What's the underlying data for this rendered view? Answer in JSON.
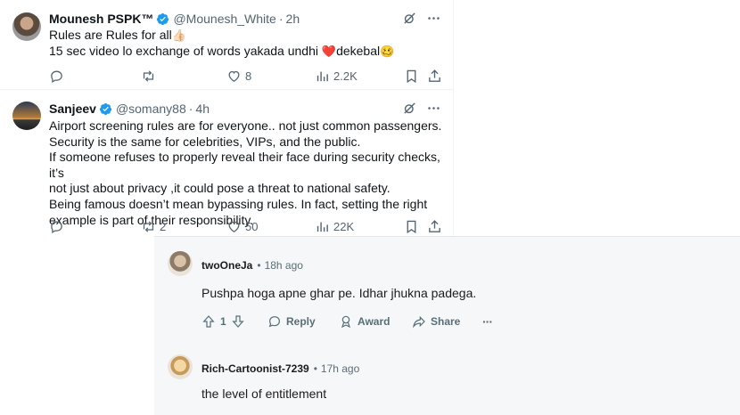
{
  "twitter": {
    "tweets": [
      {
        "name": "Mounesh PSPK™",
        "handle": "@Mounesh_White",
        "time": "2h",
        "lines": [
          "Rules are Rules for all",
          " 15 sec video lo exchange of words yakada undhi ",
          "dekebal"
        ],
        "emojis": [
          "👍🏻",
          "❤️",
          "🥴"
        ],
        "actions": {
          "replies": "",
          "reposts": "",
          "likes": "8",
          "views": "2.2K"
        }
      },
      {
        "name": "Sanjeev",
        "handle": "@somany88",
        "time": "4h",
        "lines": [
          "Airport screening rules are for everyone.. not just common passengers.",
          "Security is the same for celebrities, VIPs, and the public.",
          "If someone refuses to properly reveal their face during security checks, it’s",
          "not just about privacy ,it could pose a threat to national safety.",
          "Being famous doesn’t mean bypassing rules. In fact, setting the right",
          "example is part of their responsibility."
        ],
        "actions": {
          "replies": "",
          "reposts": "2",
          "likes": "50",
          "views": "22K"
        }
      }
    ],
    "dot": "·",
    "icons": [
      "verified-icon",
      "grok-icon",
      "more-icon",
      "reply-icon",
      "repost-icon",
      "like-icon",
      "views-icon",
      "bookmark-icon",
      "share-icon"
    ],
    "colors": {
      "verified": "#1d9bf0",
      "muted": "#536471",
      "text": "#0f1419"
    }
  },
  "reddit": {
    "comments": [
      {
        "user": "twoOneJa",
        "time": "18h ago",
        "text": "Pushpa hoga apne ghar pe. Idhar jhukna padega.",
        "votes": "1",
        "reply_label": "Reply",
        "award_label": "Award",
        "share_label": "Share",
        "more_label": "···"
      },
      {
        "user": "Rich-Cartoonist-7239",
        "time": "17h ago",
        "text": "the level of entitlement"
      }
    ],
    "sep": "•",
    "icons": [
      "upvote-icon",
      "downvote-icon",
      "reply-icon",
      "award-icon",
      "share-icon",
      "more-icon"
    ],
    "colors": {
      "background": "#f6f7f8",
      "muted": "#576f76",
      "text": "#1c1c1c"
    }
  }
}
